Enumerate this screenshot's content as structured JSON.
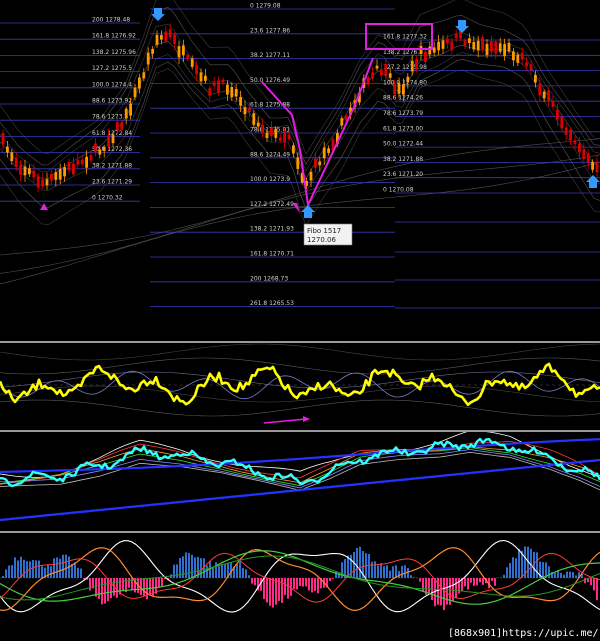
{
  "chart_data": {
    "type": "line",
    "panels": [
      "price",
      "oscillator",
      "moving-averages",
      "histogram"
    ],
    "grid": false,
    "colors": {
      "background": "#000000",
      "bull_candle": "#ff9900",
      "bear_candle": "#dd0000",
      "fibo_line": "#3a3ab8",
      "fibo_label": "#d0d0d0",
      "highlight": "#e020e0",
      "signal_arrow": "#3399ff",
      "oscillator": "#ffff00",
      "ma_fast": "#33ffff",
      "hist_up": "#2f6fd0",
      "hist_down": "#ff2a8a",
      "separator": "#9a9a9a"
    },
    "fibo_left": [
      {
        "level": "200",
        "price": "1278.48"
      },
      {
        "level": "161.8",
        "price": "1276.92"
      },
      {
        "level": "138.2",
        "price": "1275.96"
      },
      {
        "level": "127.2",
        "price": "1275.5"
      },
      {
        "level": "100.0",
        "price": "1274.4"
      },
      {
        "level": "88.6",
        "price": "1273.92"
      },
      {
        "level": "78.6",
        "price": "1273.5"
      },
      {
        "level": "61.8",
        "price": "1272.84"
      },
      {
        "level": "50.0",
        "price": "1272.36"
      },
      {
        "level": "38.2",
        "price": "1271.88"
      },
      {
        "level": "23.6",
        "price": "1271.29"
      },
      {
        "level": "0",
        "price": "1270.32"
      }
    ],
    "fibo_middle": [
      {
        "level": "0",
        "price": "1279.08"
      },
      {
        "level": "23.6",
        "price": "1277.86"
      },
      {
        "level": "38.2",
        "price": "1277.11"
      },
      {
        "level": "50.0",
        "price": "1276.49"
      },
      {
        "level": "61.8",
        "price": "1275.88"
      },
      {
        "level": "78.6",
        "price": "1275.01"
      },
      {
        "level": "88.6",
        "price": "1274.49"
      },
      {
        "level": "100.0",
        "price": "1273.9"
      },
      {
        "level": "127.2",
        "price": "1272.49"
      },
      {
        "level": "138.2",
        "price": "1271.93"
      },
      {
        "level": "161.8",
        "price": "1270.71"
      },
      {
        "level": "200",
        "price": "1268.73"
      },
      {
        "level": "261.8",
        "price": "1265.53"
      }
    ],
    "fibo_right": [
      {
        "level": "161.8",
        "price": "1277.32"
      },
      {
        "level": "138.2",
        "price": "1276.3"
      },
      {
        "level": "127.2",
        "price": "1275.98"
      },
      {
        "level": "100.0",
        "price": "1274.80"
      },
      {
        "level": "88.6",
        "price": "1274.26"
      },
      {
        "level": "78.6",
        "price": "1273.79"
      },
      {
        "level": "61.8",
        "price": "1273.00"
      },
      {
        "level": "50.0",
        "price": "1272.44"
      },
      {
        "level": "38.2",
        "price": "1271.88"
      },
      {
        "level": "23.6",
        "price": "1271.20"
      },
      {
        "level": "0",
        "price": "1270.08"
      }
    ],
    "tooltip": {
      "line1": "Fibo 1517",
      "line2": "1270.06"
    },
    "watermark": "[868x901]https://upic.me/"
  }
}
